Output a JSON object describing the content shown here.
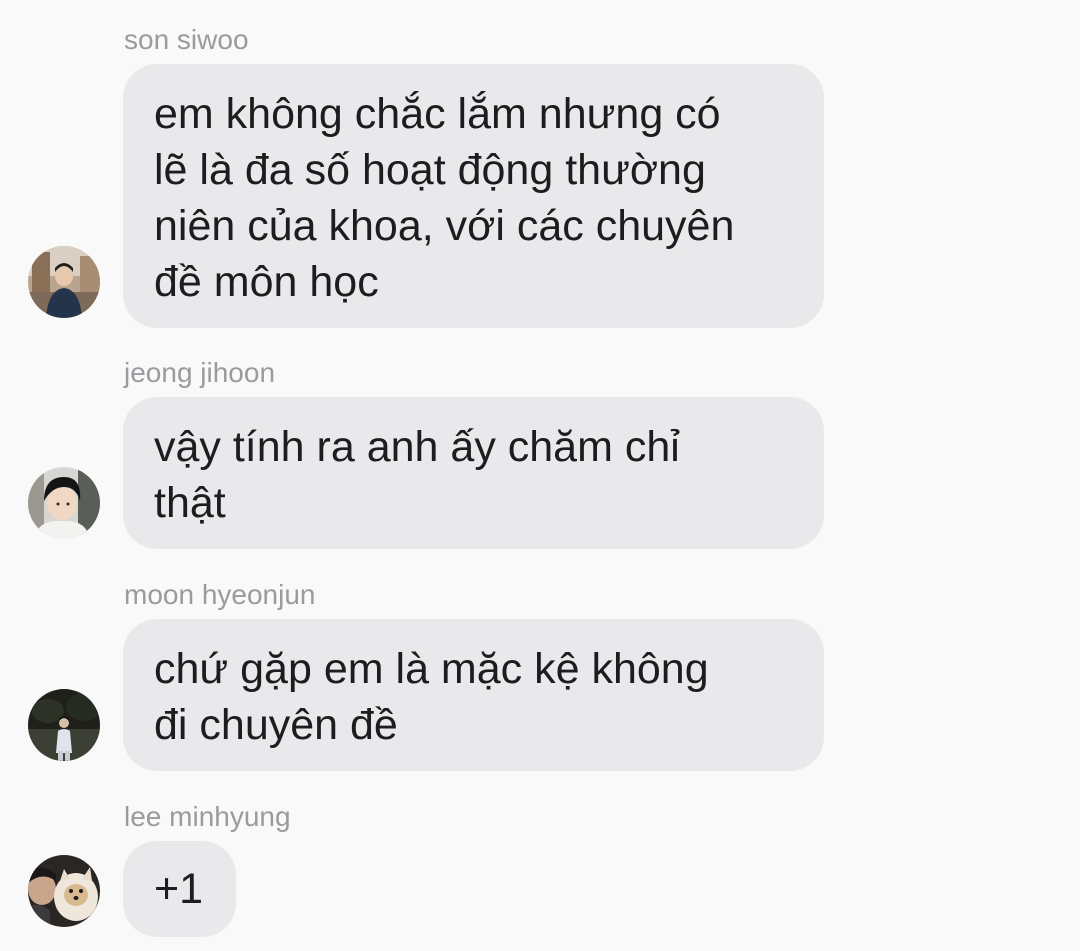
{
  "messages": [
    {
      "sender": "son siwoo",
      "text": "em không chắc lắm nhưng có\nlẽ là đa số hoạt động thường\nniên của khoa, với các chuyên\nđề môn học"
    },
    {
      "sender": "jeong jihoon",
      "text": "vậy tính ra anh ấy chăm chỉ\nthật"
    },
    {
      "sender": "moon hyeonjun",
      "text": "chứ gặp em là mặc kệ không\nđi chuyên đề"
    },
    {
      "sender": "lee minhyung",
      "text": "+1"
    }
  ],
  "colors": {
    "background": "#f9f9f9",
    "bubble": "#e9e9eb",
    "sender_name": "#9a9a9f",
    "message_text": "#1d1d1f"
  }
}
